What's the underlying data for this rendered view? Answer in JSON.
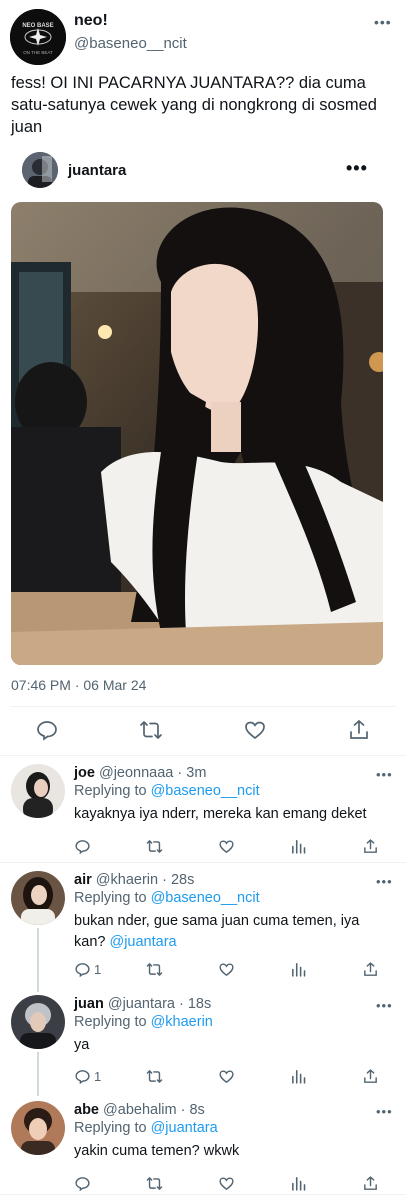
{
  "tweet": {
    "display_name": "neo!",
    "handle": "@baseneo__ncit",
    "logo_text_top": "NEO BASE",
    "logo_text_bottom": "ON THE BEAT",
    "more": "•••",
    "text": "fess! OI INI PACARNYA JUANTARA?? dia cuma satu-satunya cewek yang di nongkrong di sosmed juan",
    "embed": {
      "username": "juantara",
      "more": "•••"
    },
    "timestamp": "07:46 PM · 06 Mar 24"
  },
  "replies": [
    {
      "name": "joe",
      "handle": "@jeonnaaa",
      "time": "· 3m",
      "replying_prefix": "Replying to ",
      "replying_to": "@baseneo__ncit",
      "text": "kayaknya iya nderr, mereka kan emang deket",
      "mention": "",
      "reply_count": "",
      "more": "•••"
    },
    {
      "name": "air",
      "handle": "@khaerin",
      "time": "· 28s",
      "replying_prefix": "Replying to ",
      "replying_to": "@baseneo__ncit",
      "text": "bukan nder, gue sama juan cuma temen, iya kan?",
      "mention": "@juantara",
      "reply_count": "1",
      "more": "•••"
    },
    {
      "name": "juan",
      "handle": "@juantara",
      "time": "· 18s",
      "replying_prefix": "Replying to ",
      "replying_to": "@khaerin",
      "text": "ya",
      "mention": "",
      "reply_count": "1",
      "more": "•••"
    },
    {
      "name": "abe",
      "handle": "@abehalim",
      "time": "· 8s",
      "replying_prefix": "Replying to ",
      "replying_to": "@juantara",
      "text": "yakin cuma temen? wkwk",
      "mention": "",
      "reply_count": "",
      "more": "•••"
    }
  ],
  "icons": {
    "reply": "reply-icon",
    "retweet": "retweet-icon",
    "like": "heart-icon",
    "share": "share-icon",
    "analytics": "analytics-icon",
    "more": "more-icon"
  },
  "colors": {
    "link": "#1d9bf0",
    "secondary": "#536471",
    "text": "#0f1419",
    "thread_line": "#cfd9de"
  }
}
